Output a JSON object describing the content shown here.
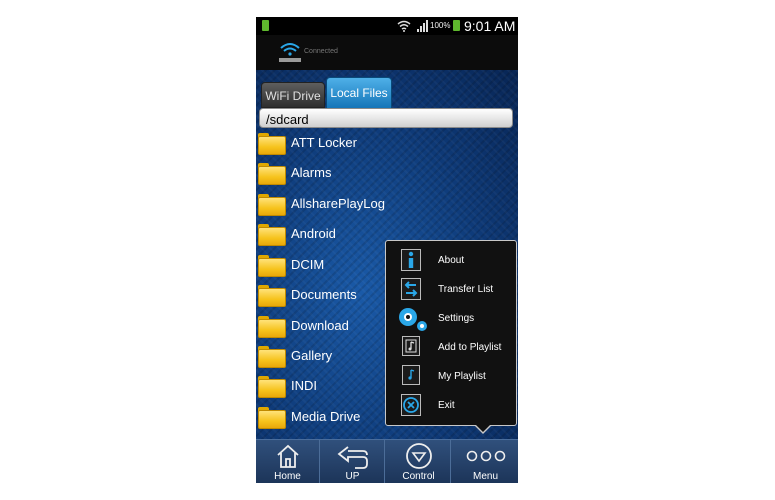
{
  "status_bar": {
    "battery_percent": "100%",
    "time": "9:01 AM"
  },
  "header": {
    "connection_status": "Connected"
  },
  "tabs": [
    {
      "label": "WiFi Drive",
      "active": false
    },
    {
      "label": "Local Files",
      "active": true
    }
  ],
  "path": "/sdcard",
  "folders": [
    "ATT Locker",
    "Alarms",
    "AllsharePlayLog",
    "Android",
    "DCIM",
    "Documents",
    "Download",
    "Gallery",
    "INDI",
    "Media Drive"
  ],
  "menu": [
    {
      "label": "About",
      "icon": "info-icon"
    },
    {
      "label": "Transfer List",
      "icon": "transfer-arrows-icon"
    },
    {
      "label": "Settings",
      "icon": "gears-icon"
    },
    {
      "label": "Add to Playlist",
      "icon": "add-to-playlist-icon"
    },
    {
      "label": "My Playlist",
      "icon": "playlist-icon"
    },
    {
      "label": "Exit",
      "icon": "close-circle-icon"
    }
  ],
  "bottom_nav": [
    {
      "label": "Home",
      "icon": "home-icon"
    },
    {
      "label": "UP",
      "icon": "back-arrow-icon"
    },
    {
      "label": "Control",
      "icon": "control-down-icon"
    },
    {
      "label": "Menu",
      "icon": "more-dots-icon"
    }
  ],
  "colors": {
    "background_blue": "#0e3a78",
    "active_tab": "#1f8fd8",
    "folder_yellow": "#f6c31c",
    "accent_icon": "#2aa7e8"
  }
}
